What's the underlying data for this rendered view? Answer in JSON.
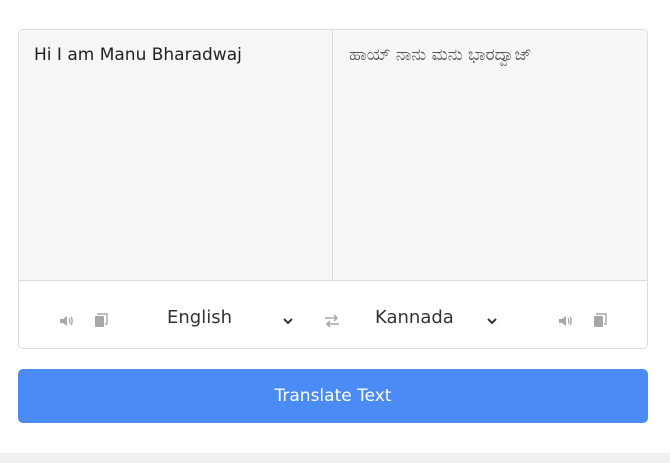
{
  "from": {
    "text": "Hi I am Manu Bharadwaj",
    "language": "English"
  },
  "to": {
    "text": "ಹಾಯ್ ನಾನು ಮನು ಭಾರದ್ವಾಜ್",
    "language": "Kannada"
  },
  "icons": {
    "from_speak": "volume-icon",
    "from_copy": "copy-icon",
    "exchange": "exchange-icon",
    "to_speak": "volume-icon",
    "to_copy": "copy-icon"
  },
  "button": {
    "label": "Translate Text"
  },
  "colors": {
    "accent": "#4a8bf5",
    "panel": "#f6f6f6",
    "icon": "#a7a7a7"
  }
}
